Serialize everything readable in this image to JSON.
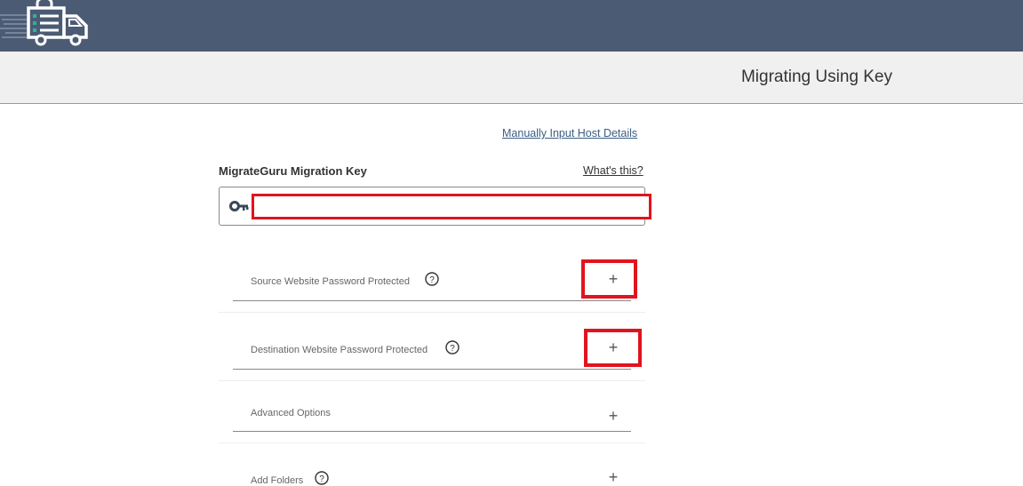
{
  "app": {
    "page_title": "Migrating Using Key"
  },
  "links": {
    "manual_host": "Manually Input Host Details",
    "whats_this": "What's this?"
  },
  "key_field": {
    "label": "MigrateGuru Migration Key",
    "value": "",
    "placeholder": "",
    "icon": "key-icon"
  },
  "sections": [
    {
      "label": "Source Website Password Protected",
      "has_help": true,
      "toggle": "+"
    },
    {
      "label": "Destination Website Password Protected",
      "has_help": true,
      "toggle": "+"
    },
    {
      "label": "Advanced Options",
      "has_help": false,
      "toggle": "+"
    },
    {
      "label": "Add Folders",
      "has_help": true,
      "toggle": "+"
    }
  ],
  "colors": {
    "topbar": "#4b5b74",
    "subheader": "#f0f0f0",
    "highlight": "#e0141e",
    "link": "#3b5e85"
  }
}
